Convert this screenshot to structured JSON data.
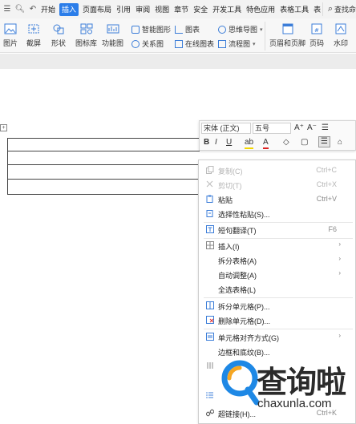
{
  "tabs": {
    "items": [
      "开始",
      "插入",
      "页面布局",
      "引用",
      "审阅",
      "视图",
      "章节",
      "安全",
      "开发工具",
      "特色应用",
      "表格工具",
      "表"
    ],
    "active": "插入",
    "search_label": "查找命"
  },
  "ribbon": {
    "picture": "图片",
    "screenshot": "截屏",
    "shape": "形状",
    "icon_lib": "图标库",
    "func_chart": "功能图",
    "smart_art": "智能图形",
    "chart": "图表",
    "mind_map": "思维导图",
    "relation": "关系图",
    "online_chart": "在线图表",
    "flow": "流程图",
    "header_footer": "页眉和页脚",
    "page_num": "页码",
    "watermark": "水印"
  },
  "mini_toolbar": {
    "font": "宋体 (正文)",
    "size": "五号"
  },
  "context_menu": {
    "items": [
      {
        "label": "复制(C)",
        "key": "Ctrl+C",
        "disabled": true,
        "icon": "copy-icon"
      },
      {
        "label": "剪切(T)",
        "key": "Ctrl+X",
        "disabled": true,
        "icon": "scissors-icon"
      },
      {
        "label": "粘贴",
        "key": "Ctrl+V",
        "disabled": false,
        "icon": "paste-icon"
      },
      {
        "label": "选择性粘贴(S)...",
        "key": "",
        "disabled": false,
        "icon": "paste-special-icon"
      },
      {
        "label": "短句翻译(T)",
        "key": "F6",
        "disabled": false,
        "icon": "translate-icon"
      },
      {
        "label": "插入(I)",
        "key": "",
        "disabled": false,
        "icon": "insert-icon",
        "submenu": true
      },
      {
        "label": "拆分表格(A)",
        "key": "",
        "disabled": false,
        "icon": "",
        "submenu": true
      },
      {
        "label": "自动调整(A)",
        "key": "",
        "disabled": false,
        "icon": "",
        "submenu": true
      },
      {
        "label": "全选表格(L)",
        "key": "",
        "disabled": false,
        "icon": ""
      },
      {
        "label": "拆分单元格(P)...",
        "key": "",
        "disabled": false,
        "icon": "split-cell-icon"
      },
      {
        "label": "删除单元格(D)...",
        "key": "",
        "disabled": false,
        "icon": "delete-cell-icon"
      },
      {
        "label": "单元格对齐方式(G)",
        "key": "",
        "disabled": false,
        "icon": "cell-align-icon",
        "submenu": true
      },
      {
        "label": "边框和底纹(B)...",
        "key": "",
        "disabled": false,
        "icon": ""
      },
      {
        "label": "超链接(H)...",
        "key": "Ctrl+K",
        "disabled": false,
        "icon": "link-icon"
      }
    ]
  },
  "watermark": {
    "brand": "查询啦",
    "domain": "chaxunla.com",
    "logo_icon": "magnifier-logo"
  },
  "colors": {
    "accent": "#2b7de9",
    "logo_blue": "#1e88e5",
    "logo_orange": "#f5a623"
  }
}
